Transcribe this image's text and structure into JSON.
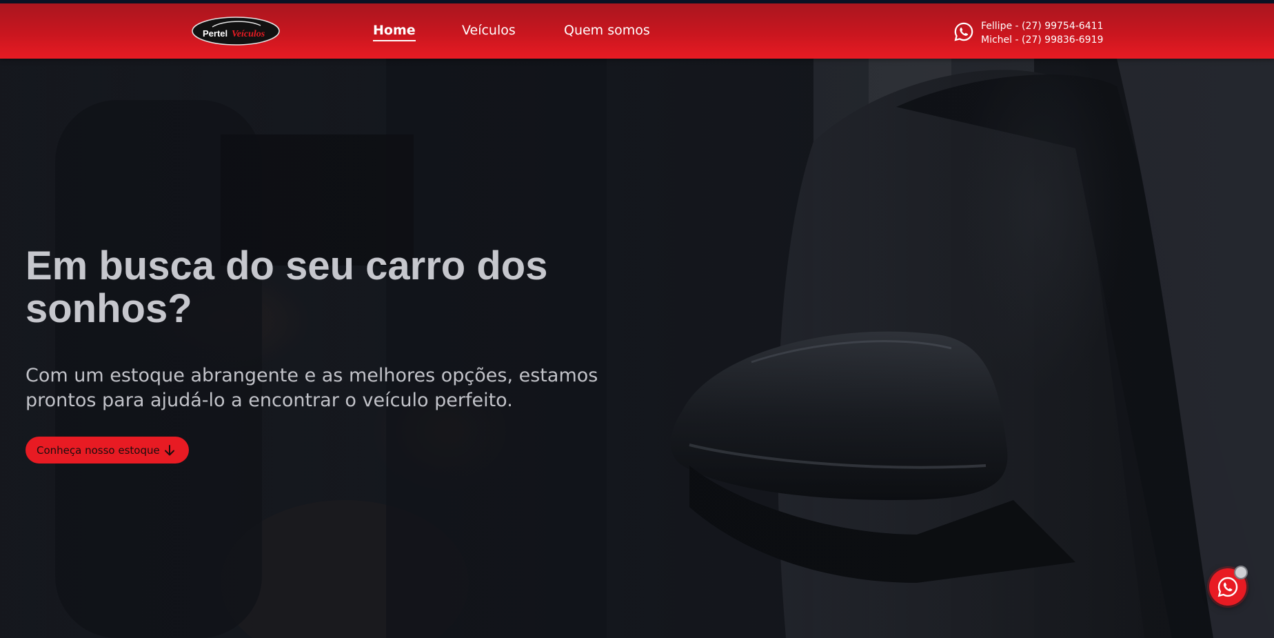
{
  "brand": {
    "logo_part1": "Pertel",
    "logo_part2": "Veículos"
  },
  "nav": {
    "items": [
      {
        "label": "Home",
        "active": true
      },
      {
        "label": "Veículos",
        "active": false
      },
      {
        "label": "Quem somos",
        "active": false
      }
    ]
  },
  "contact": {
    "icon": "whatsapp-icon",
    "line1": "Fellipe - (27) 99754-6411",
    "line2": "Michel - (27) 99836-6919"
  },
  "hero": {
    "title": "Em busca do seu carro dos sonhos?",
    "subtitle": "Com um estoque abrangente e as melhores opções, estamos prontos para ajudá-lo a encontrar o veículo perfeito.",
    "cta_label": "Conheça nosso estoque",
    "cta_icon": "arrow-down-icon"
  },
  "floating": {
    "icon": "whatsapp-icon"
  },
  "colors": {
    "brand_red": "#e81b23",
    "nav_dark_red": "#a9161f",
    "hero_text": "#c6c7cd"
  }
}
